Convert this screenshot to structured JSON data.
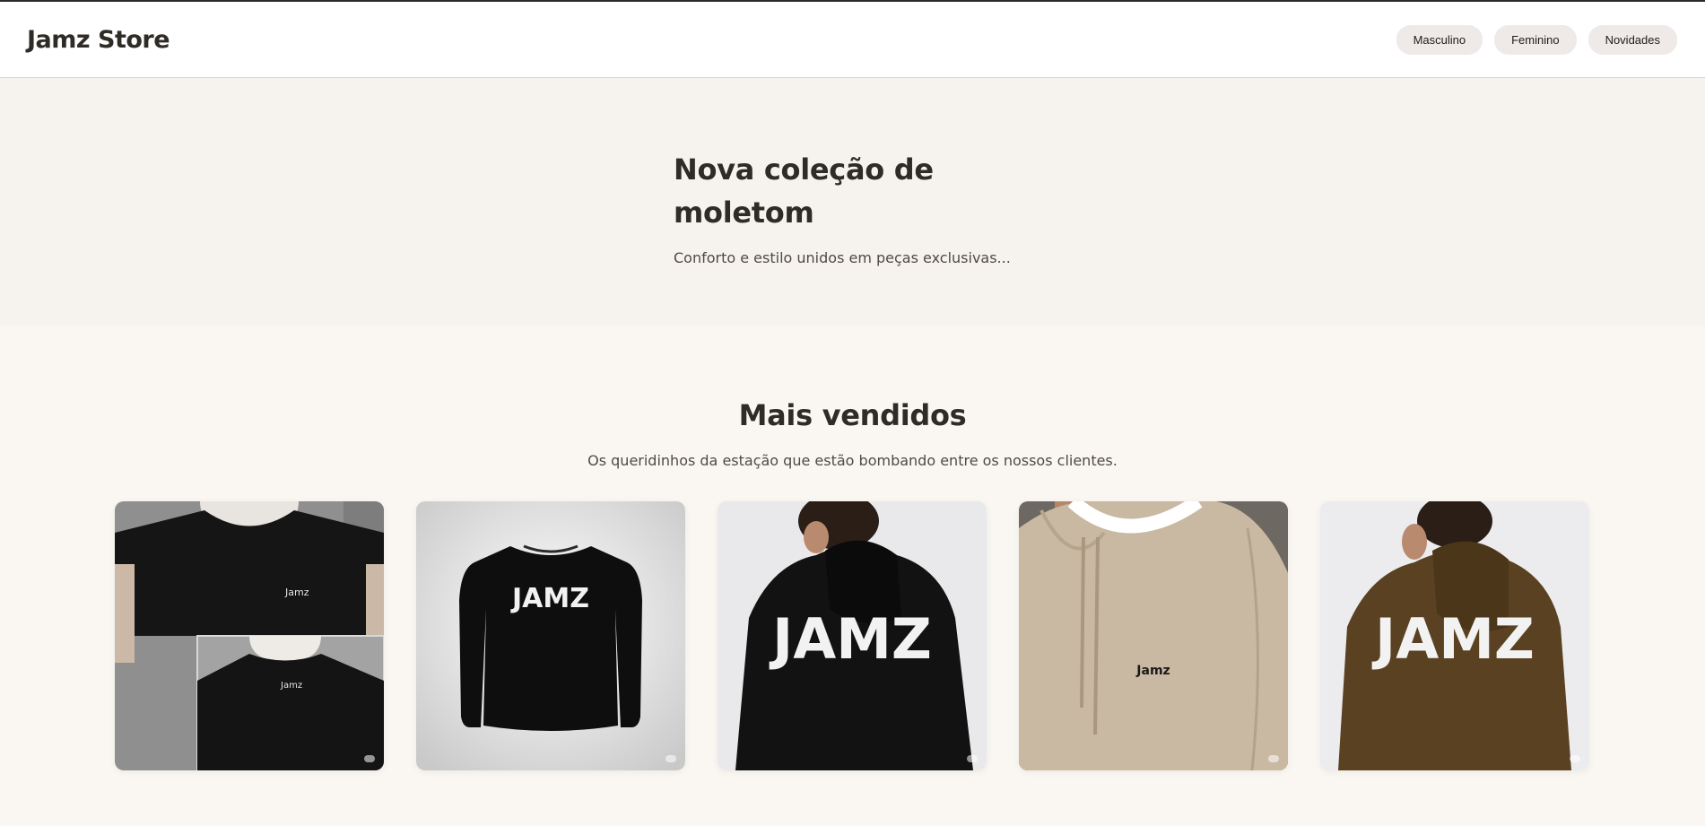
{
  "header": {
    "logo": "Jamz Store",
    "nav": [
      "Masculino",
      "Feminino",
      "Novidades"
    ]
  },
  "hero": {
    "title": "Nova coleção de moletom",
    "subtitle": "Conforto e estilo unidos em peças exclusivas..."
  },
  "bestsellers": {
    "title": "Mais vendidos",
    "subtitle": "Os queridinhos da estação que estão bombando entre os nossos clientes.",
    "products": [
      {
        "print": "Jamz",
        "back_print": "Jamz",
        "color": "#151515",
        "sleeve_color": "#cbb8a6"
      },
      {
        "print": "JAMZ",
        "color": "#0e0e0e"
      },
      {
        "print": "JAMZ",
        "color": "#121212"
      },
      {
        "print": "Jamz",
        "color": "#c9b9a2"
      },
      {
        "print": "JAMZ",
        "color": "#5a4121"
      }
    ]
  },
  "colors": {
    "page_bg": "#faf7f2",
    "hero_bg": "#f6f2ed",
    "nav_pill": "#efe9e7",
    "text_dark": "#2f2b27"
  }
}
